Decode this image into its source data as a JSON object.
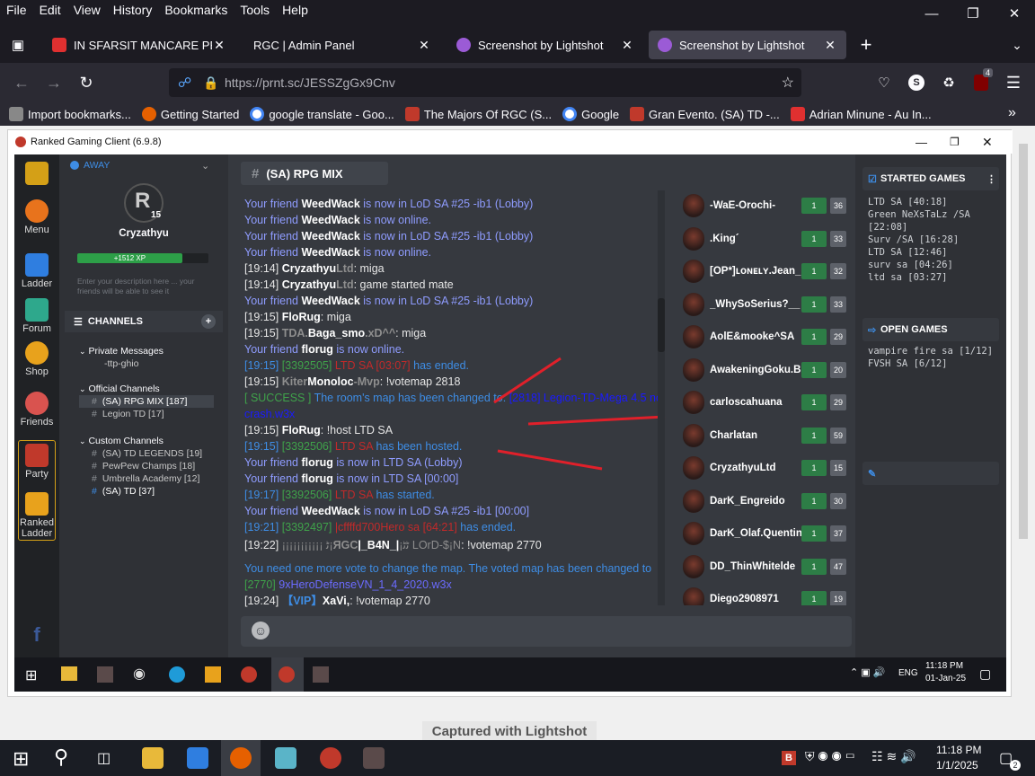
{
  "menubar": {
    "items": [
      "File",
      "Edit",
      "View",
      "History",
      "Bookmarks",
      "Tools",
      "Help"
    ]
  },
  "tabs": [
    {
      "label": "IN SFARSIT MANCARE PESTE M",
      "color": "#e03030"
    },
    {
      "label": "RGC | Admin Panel",
      "color": "#1c1b22"
    },
    {
      "label": "Screenshot by Lightshot",
      "color": "#9b5bd6"
    },
    {
      "label": "Screenshot by Lightshot",
      "color": "#9b5bd6",
      "active": true
    }
  ],
  "nav": {
    "url": "https://prnt.sc/JESSZgGx9Cnv",
    "badge_count": "4"
  },
  "bookmarks": [
    {
      "label": "Import bookmarks...",
      "color": "#888"
    },
    {
      "label": "Getting Started",
      "color": "#e66000"
    },
    {
      "label": "google translate - Goo...",
      "color": "#4285f4"
    },
    {
      "label": "The Majors Of RGC (S...",
      "color": "#c0392b"
    },
    {
      "label": "Google",
      "color": "#4285f4"
    },
    {
      "label": "Gran Evento. (SA) TD -...",
      "color": "#c0392b"
    },
    {
      "label": "Adrian Minune - Au In...",
      "color": "#e03030"
    }
  ],
  "rgc": {
    "title": "Ranked Gaming Client (6.9.8)",
    "leftbar": [
      {
        "label": "",
        "color": "#d4a017"
      },
      {
        "label": "Menu",
        "color": "#e8731c"
      },
      {
        "label": "Ladder",
        "color": "#2f7ee0"
      },
      {
        "label": "Forum",
        "color": "#2ea88c"
      },
      {
        "label": "Shop",
        "color": "#e8a21c"
      },
      {
        "label": "Friends",
        "color": "#d9534f"
      },
      {
        "label": "Party",
        "color": "#c0392b"
      },
      {
        "label": "Ranked Ladder",
        "color": "#e8a21c"
      }
    ],
    "profile": {
      "status": "AWAY",
      "level": "15",
      "username": "Cryzathyu",
      "xp": "+1512 XP",
      "description_placeholder": "Enter your description here ... your friends will be able to see it",
      "channels_label": "CHANNELS",
      "groups": [
        {
          "name": "Private Messages",
          "items": [
            "-ttp-ghio"
          ]
        },
        {
          "name": "Official Channels",
          "items": [
            "(SA) RPG MIX [187]",
            "Legion TD [17]"
          ]
        },
        {
          "name": "Custom Channels",
          "items": [
            "(SA) TD LEGENDS [19]",
            "PewPew Champs [18]",
            "Umbrella Academy [12]",
            "(SA) TD [37]"
          ]
        }
      ]
    },
    "channel_title": "(SA) RPG MIX",
    "users": [
      {
        "name": "-WaE-Orochi-",
        "lvl": "1",
        "n": "36"
      },
      {
        "name": ".King´",
        "lvl": "1",
        "n": "33"
      },
      {
        "name": "[OP*]ʟᴏɴᴇʟʏ.Jean_D",
        "lvl": "1",
        "n": "32"
      },
      {
        "name": "_WhySoSerius?__",
        "lvl": "1",
        "n": "33"
      },
      {
        "name": "AolE&mooke^SA",
        "lvl": "1",
        "n": "29"
      },
      {
        "name": "AwakeningGoku.Blac",
        "lvl": "1",
        "n": "20"
      },
      {
        "name": "carloscahuana",
        "lvl": "1",
        "n": "29"
      },
      {
        "name": "Charlatan",
        "lvl": "1",
        "n": "59"
      },
      {
        "name": "CryzathyuLtd",
        "lvl": "1",
        "n": "15"
      },
      {
        "name": "DarK_Engreido",
        "lvl": "1",
        "n": "30"
      },
      {
        "name": "DarK_Olaf.Quentinh",
        "lvl": "1",
        "n": "37"
      },
      {
        "name": "DD_ThinWhitelde",
        "lvl": "1",
        "n": "47"
      },
      {
        "name": "Diego2908971",
        "lvl": "1",
        "n": "19"
      }
    ],
    "started_games": {
      "title": "STARTED GAMES",
      "items": [
        "LTD SA [40:18]",
        "Green NeXsTaLz /SA [22:08]",
        "Surv /SA [16:28]",
        "LTD SA [12:46]",
        "surv sa [04:26]",
        "ltd sa [03:27]"
      ]
    },
    "open_games": {
      "title": "OPEN GAMES",
      "items": [
        "vampire fire sa [1/12]",
        "FVSH SA [6/12]"
      ]
    },
    "inner_taskbar": {
      "time": "11:18 PM",
      "date": "01-Jan-25",
      "lang": "ENG"
    }
  },
  "captured": "Captured with Lightshot",
  "taskbar": {
    "time": "11:18 PM",
    "date": "1/1/2025",
    "notif": "2"
  }
}
